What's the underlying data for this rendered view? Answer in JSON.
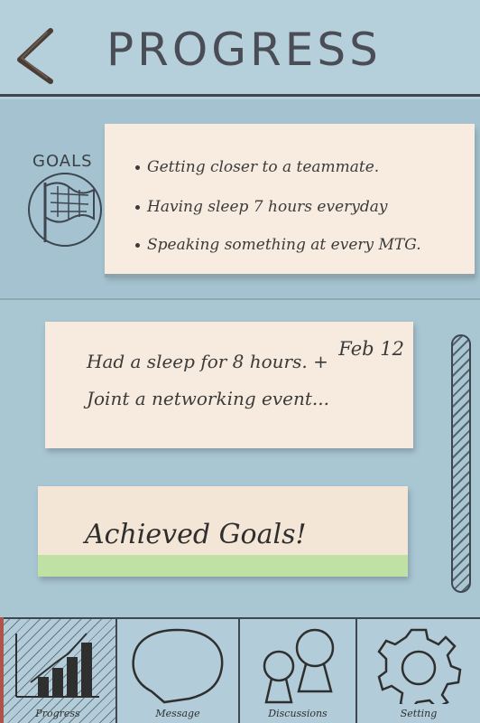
{
  "header": {
    "title": "PROGRESS",
    "back_icon": "chevron-left-icon"
  },
  "goals": {
    "label": "GOALS",
    "icon": "flag-icon",
    "items": [
      {
        "text": "Getting closer to a teammate."
      },
      {
        "text": "Having sleep 7 hours everyday"
      },
      {
        "text": "Speaking something at every MTG."
      }
    ]
  },
  "diary": {
    "date": "Feb 12",
    "text": "Had a sleep for 8 hours. + Joint a networking event..."
  },
  "achieved": {
    "label": "Achieved Goals!"
  },
  "tabs": [
    {
      "id": "progress",
      "label": "Progress",
      "icon": "bar-chart-icon",
      "active": true
    },
    {
      "id": "message",
      "label": "Message",
      "icon": "speech-bubble-icon",
      "active": false
    },
    {
      "id": "discussions",
      "label": "Discussions",
      "icon": "people-icon",
      "active": false
    },
    {
      "id": "setting",
      "label": "Setting",
      "icon": "gear-icon",
      "active": false
    }
  ],
  "colors": {
    "paper": "#a9c6d3",
    "card": "#f8ece1",
    "tape": "#bfe1a3",
    "ink": "#3e4650"
  }
}
